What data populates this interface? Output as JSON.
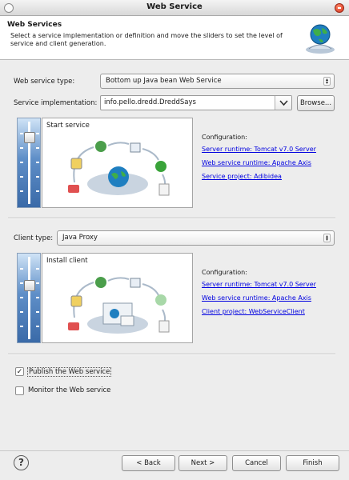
{
  "window": {
    "title": "Web Service"
  },
  "banner": {
    "title": "Web Services",
    "description": "Select a service implementation or definition and move the sliders to set the level of service and client generation."
  },
  "service": {
    "type_label": "Web service type:",
    "type_value": "Bottom up Java bean Web Service",
    "impl_label": "Service implementation:",
    "impl_value": "info.pello.dredd.DreddSays",
    "browse_label": "Browse...",
    "diagram_label": "Start service",
    "config_title": "Configuration:",
    "links": [
      "Server runtime: Tomcat v7.0 Server",
      "Web service runtime: Apache Axis",
      "Service project: Adibidea"
    ],
    "slider_level": "Start service"
  },
  "client": {
    "type_label": "Client type:",
    "type_value": "Java Proxy",
    "diagram_label": "Install client",
    "config_title": "Configuration:",
    "links": [
      "Server runtime: Tomcat v7.0 Server",
      "Web service runtime: Apache Axis",
      "Client project: WebServiceClient"
    ],
    "slider_level": "Install client"
  },
  "options": {
    "publish_label": "Publish the Web service",
    "publish_checked": true,
    "monitor_label": "Monitor the Web service",
    "monitor_checked": false
  },
  "buttons": {
    "back": "< Back",
    "next": "Next >",
    "cancel": "Cancel",
    "finish": "Finish"
  },
  "icons": {
    "help": "help-icon",
    "banner": "globe-webservice-icon"
  },
  "colors": {
    "link": "#0000e0",
    "slider": "#5f8fc8",
    "close": "#d4301a"
  }
}
